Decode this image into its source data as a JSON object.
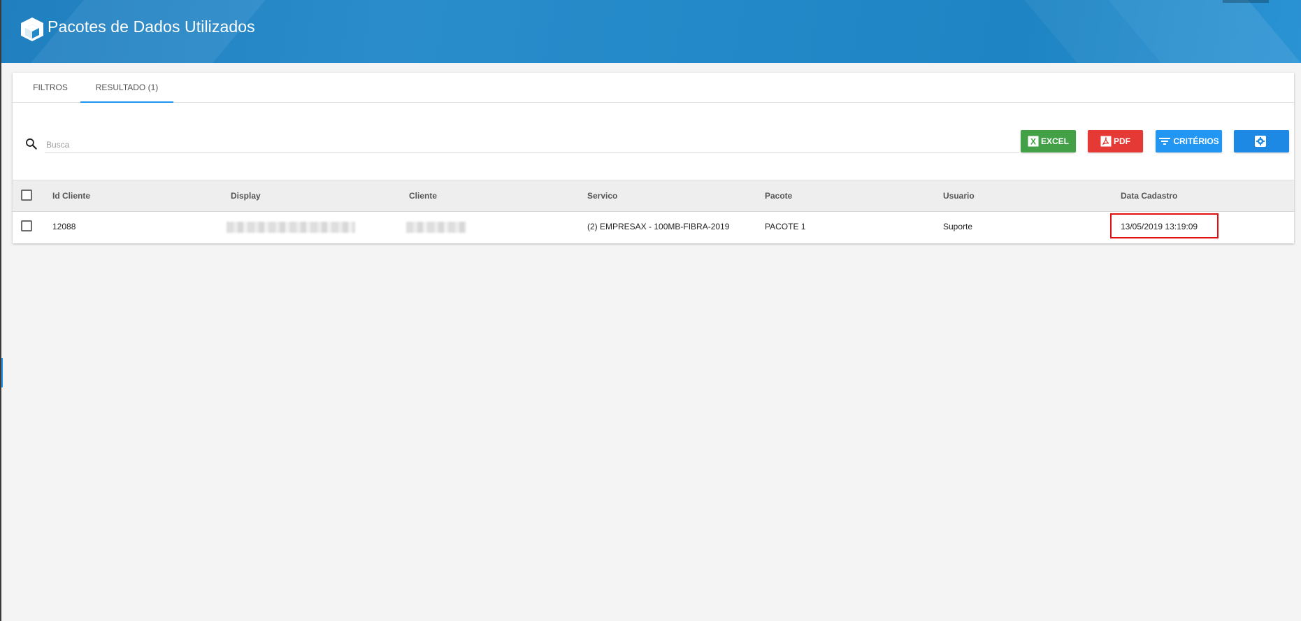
{
  "header": {
    "title": "Pacotes de Dados Utilizados",
    "icon": "box-icon"
  },
  "tabs": [
    {
      "label": "FILTROS",
      "active": false
    },
    {
      "label": "RESULTADO (1)",
      "active": true
    }
  ],
  "search": {
    "placeholder": "Busca",
    "value": ""
  },
  "toolbar": {
    "excel_label": "EXCEL",
    "pdf_label": "PDF",
    "criterios_label": "CRITÉRIOS",
    "config_label": ""
  },
  "colors": {
    "header": "#2389c8",
    "tab_indicator": "#2196f3",
    "excel": "#43a047",
    "pdf": "#e53935",
    "criterios": "#2196f3",
    "config": "#1e88e5",
    "highlight": "#e01010"
  },
  "table": {
    "columns": [
      "Id Cliente",
      "Display",
      "Cliente",
      "Servico",
      "Pacote",
      "Usuario",
      "Data Cadastro"
    ],
    "rows": [
      {
        "id_cliente": "12088",
        "display": "",
        "cliente": "",
        "servico": "(2) EMPRESAX - 100MB-FIBRA-2019",
        "pacote": "PACOTE 1",
        "usuario": "Suporte",
        "data_cadastro": "13/05/2019 13:19:09"
      }
    ]
  }
}
